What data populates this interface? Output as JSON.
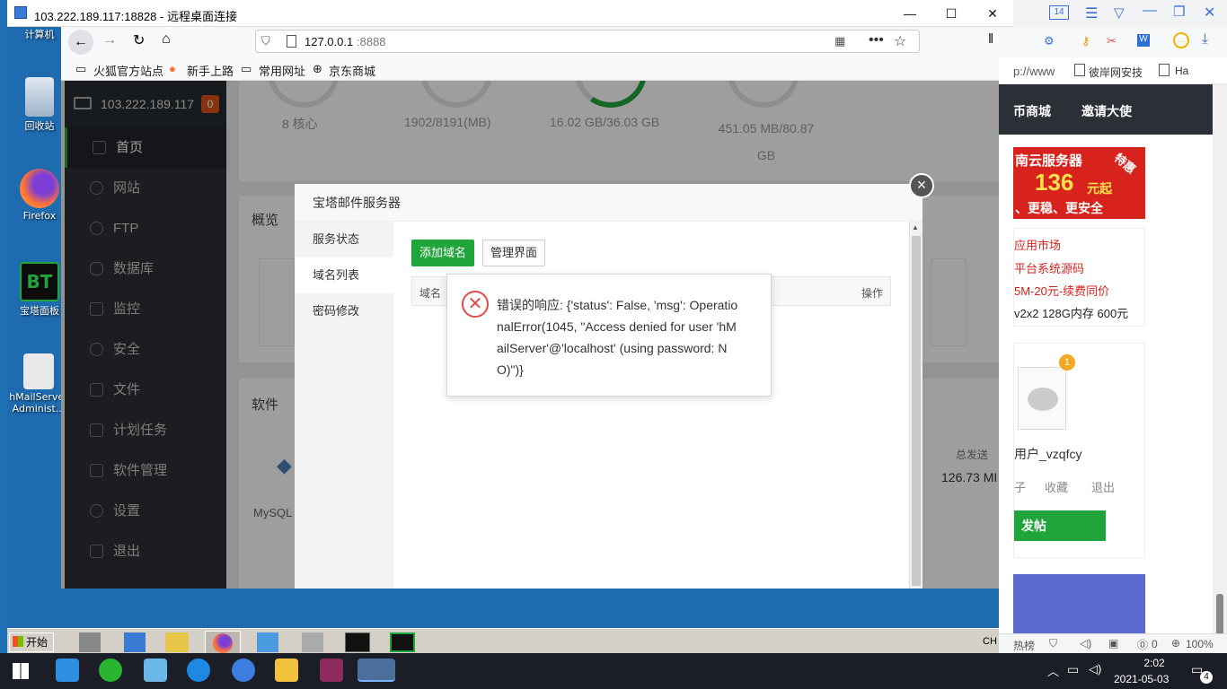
{
  "rdp": {
    "title": "103.222.189.117:18828 - 远程桌面连接"
  },
  "desktop_icons": [
    {
      "label": "计算机",
      "icon": "computer-icon"
    },
    {
      "label": "回收站",
      "icon": "recycle-bin-icon"
    },
    {
      "label": "Firefox",
      "icon": "firefox-icon"
    },
    {
      "label": "宝塔面板",
      "icon": "bt-panel-icon"
    },
    {
      "label": "hMailServer Administ...",
      "icon": "hmailserver-icon"
    }
  ],
  "browser": {
    "url_prefix": "127.0.0.1",
    "url_port": ":8888",
    "bookmarks": [
      "火狐官方站点",
      "新手上路",
      "常用网址",
      "京东商城"
    ]
  },
  "panel": {
    "ip": "103.222.189.117",
    "badge": "0",
    "menu": [
      "首页",
      "网站",
      "FTP",
      "数据库",
      "监控",
      "安全",
      "文件",
      "计划任务",
      "软件管理",
      "设置",
      "退出"
    ],
    "stats": [
      "8 核心",
      "1902/8191(MB)",
      "16.02 GB/36.03 GB",
      "451.05 MB/80.87 GB"
    ],
    "overview_title": "概览",
    "software_title": "软件",
    "mysql_label": "MySQL",
    "total_send_label": "总发送",
    "total_send_value": "126.73 MI"
  },
  "modal": {
    "title": "宝塔邮件服务器",
    "nav": [
      "服务状态",
      "域名列表",
      "密码修改"
    ],
    "add_domain": "添加域名",
    "manage": "管理界面",
    "col_domain": "域名",
    "col_action": "操作",
    "error_lines": [
      "错误的响应: {'status': False, 'msg': Operatio",
      "nalError(1045, \"Access denied for user 'hM",
      "ailServer'@'localhost' (using password: N",
      "O)\")}"
    ]
  },
  "remote_taskbar": {
    "start": "开始",
    "lang": "CH"
  },
  "host_page": {
    "url_fragment": "p://www",
    "tab1": "彼岸网安技",
    "tab2": "Ha",
    "nav1": "币商城",
    "nav2": "邀请大使",
    "ad_line1": "南云服务器",
    "ad_price": "136",
    "ad_unit": "元起",
    "ad_line2": "、更稳、更安全",
    "ad_tag": "特惠",
    "links": [
      "应用市场",
      "平台系统源码",
      "5M-20元-续费同价",
      "v2x2 128G内存 600元"
    ],
    "notif_count": "1",
    "username": "用户_vzqfcy",
    "user_actions": [
      "子",
      "收藏",
      "退出"
    ],
    "post_button": "发帖",
    "status_hot": "热榜",
    "status_zero": "0",
    "zoom": "100%"
  },
  "taskbar": {
    "time": "2:02",
    "date": "2021-05-03",
    "notifications": "4"
  },
  "colors": {
    "accent_green": "#20a53a",
    "sidebar": "#2d3035",
    "error_red": "#e04b4b"
  }
}
